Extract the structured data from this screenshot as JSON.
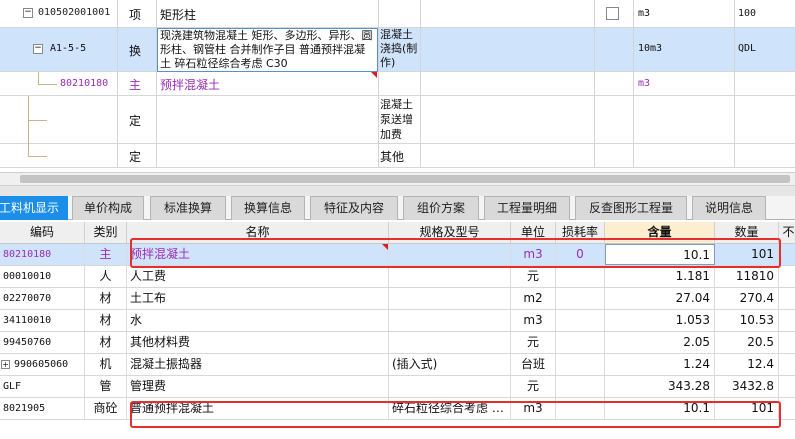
{
  "top_rows": [
    {
      "code": "010502001001",
      "type": "项",
      "name": "矩形柱",
      "unit": "m3",
      "qty": "100"
    },
    {
      "code": "A1-5-5",
      "type": "换",
      "name": "现浇建筑物混凝土 矩形、多边形、异形、圆形柱、钢管柱 合并制作子目 普通预拌混凝土 碎石粒径综合考虑 C30",
      "spec": "混凝土浇捣(制作)",
      "unit": "10m3",
      "qty": "QDL"
    },
    {
      "code": "80210180",
      "type": "主",
      "name": "预拌混凝土",
      "unit": "m3"
    },
    {
      "type": "定",
      "spec": "混凝土泵送增加费"
    },
    {
      "type": "定",
      "spec": "其他"
    }
  ],
  "tabs": [
    "工料机显示",
    "单价构成",
    "标准换算",
    "换算信息",
    "特征及内容",
    "组价方案",
    "工程量明细",
    "反查图形工程量",
    "说明信息"
  ],
  "columns": [
    "编码",
    "类别",
    "名称",
    "规格及型号",
    "单位",
    "损耗率",
    "含量",
    "数量",
    "不"
  ],
  "rows": [
    {
      "code": "80210180",
      "type": "主",
      "name": "预拌混凝土",
      "spec": "",
      "unit": "m3",
      "loss": "0",
      "content": "10.1",
      "qty": "101"
    },
    {
      "code": "00010010",
      "type": "人",
      "name": "人工费",
      "spec": "",
      "unit": "元",
      "loss": "",
      "content": "1.181",
      "qty": "11810"
    },
    {
      "code": "02270070",
      "type": "材",
      "name": "土工布",
      "spec": "",
      "unit": "m2",
      "loss": "",
      "content": "27.04",
      "qty": "270.4"
    },
    {
      "code": "34110010",
      "type": "材",
      "name": "水",
      "spec": "",
      "unit": "m3",
      "loss": "",
      "content": "1.053",
      "qty": "10.53"
    },
    {
      "code": "99450760",
      "type": "材",
      "name": "其他材料费",
      "spec": "",
      "unit": "元",
      "loss": "",
      "content": "2.05",
      "qty": "20.5"
    },
    {
      "code": "990605060",
      "type": "机",
      "name": "混凝土振捣器",
      "spec": "(插入式)",
      "unit": "台班",
      "loss": "",
      "content": "1.24",
      "qty": "12.4"
    },
    {
      "code": "GLF",
      "type": "管",
      "name": "管理费",
      "spec": "",
      "unit": "元",
      "loss": "",
      "content": "343.28",
      "qty": "3432.8"
    },
    {
      "code": "8021905",
      "type": "商砼",
      "name": "普通预拌混凝土",
      "spec": "碎石粒径综合考虑 …",
      "unit": "m3",
      "loss": "",
      "content": "10.1",
      "qty": "101"
    }
  ],
  "colors": {
    "accent": "#1a8ee8",
    "selected_row": "#cfe3fb",
    "highlight_box": "#e52e2e",
    "main_material": "#9b2cb5"
  }
}
